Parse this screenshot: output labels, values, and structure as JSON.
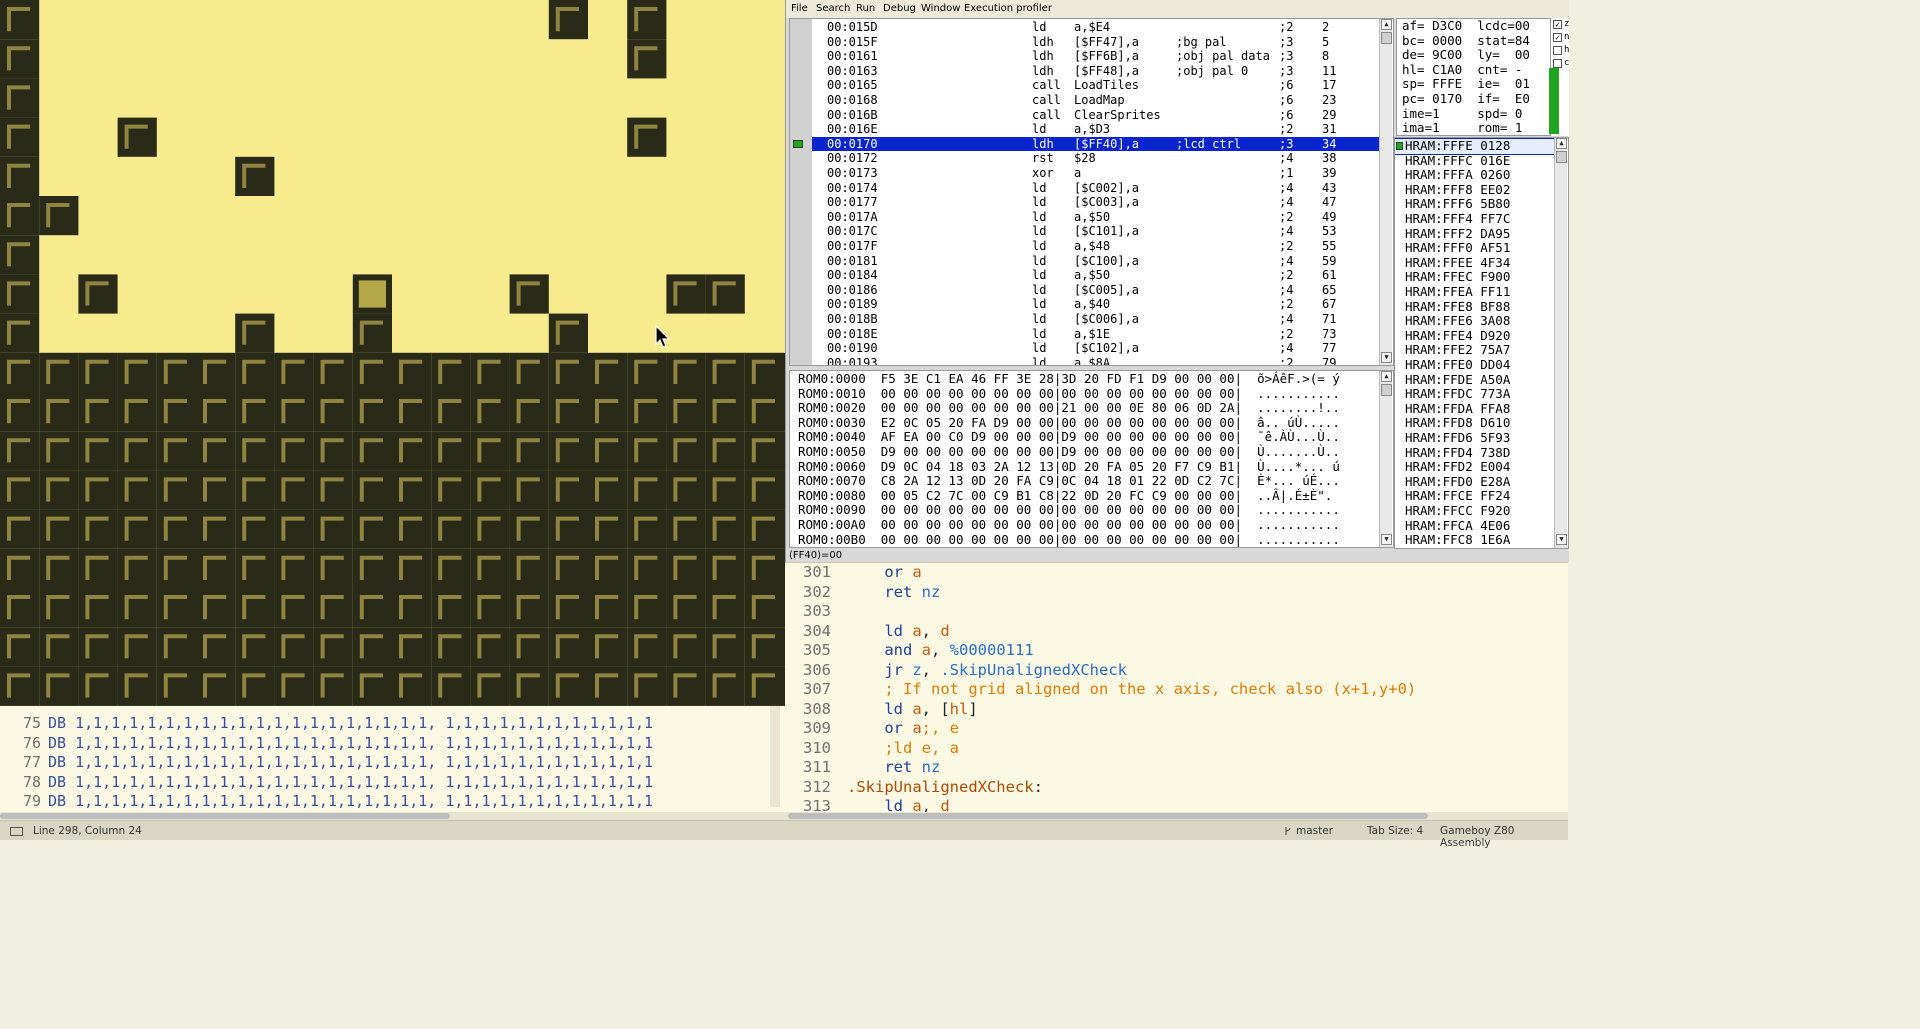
{
  "left_editor": {
    "lines": [
      {
        "num": "75",
        "text": "DB 1,1,1,1,1,1,1,1,1,1,1,1,1,1,1,1,1,1,1,1, 1,1,1,1,1,1,1,1,1,1,1,1"
      },
      {
        "num": "76",
        "text": "DB 1,1,1,1,1,1,1,1,1,1,1,1,1,1,1,1,1,1,1,1, 1,1,1,1,1,1,1,1,1,1,1,1"
      },
      {
        "num": "77",
        "text": "DB 1,1,1,1,1,1,1,1,1,1,1,1,1,1,1,1,1,1,1,1, 1,1,1,1,1,1,1,1,1,1,1,1"
      },
      {
        "num": "78",
        "text": "DB 1,1,1,1,1,1,1,1,1,1,1,1,1,1,1,1,1,1,1,1, 1,1,1,1,1,1,1,1,1,1,1,1"
      },
      {
        "num": "79",
        "text": "DB 1,1,1,1,1,1,1,1,1,1,1,1,1,1,1,1,1,1,1,1, 1,1,1,1,1,1,1,1,1,1,1,1"
      }
    ]
  },
  "game": {
    "colors": {
      "bg": "#f7eb8d",
      "dark": "#2a2a18",
      "mid": "#8f8540",
      "sprite": "#b5a84a"
    },
    "blocks": [
      [
        0,
        0
      ],
      [
        0,
        1
      ],
      [
        0,
        2
      ],
      [
        0,
        3
      ],
      [
        0,
        4
      ],
      [
        0,
        5
      ],
      [
        0,
        6
      ],
      [
        0,
        7
      ],
      [
        0,
        8
      ],
      [
        14,
        0
      ],
      [
        16,
        0
      ],
      [
        16,
        1
      ],
      [
        3,
        3
      ],
      [
        16,
        3
      ],
      [
        6,
        4
      ],
      [
        1,
        5
      ],
      [
        2,
        7
      ],
      [
        13,
        7
      ],
      [
        17,
        7
      ],
      [
        18,
        7
      ],
      [
        6,
        8
      ],
      [
        9,
        8
      ],
      [
        14,
        8
      ]
    ],
    "sprite_cell": [
      9,
      7
    ],
    "floor_from_row": 9
  },
  "debugger": {
    "menu": [
      "File",
      "Search",
      "Run",
      "Debug",
      "Window",
      "Execution profiler"
    ],
    "disasm": [
      {
        "addr": "00:015D",
        "op": "ld",
        "args": "a,$E4",
        "cm": "",
        "cyc": ";2",
        "tot": "2"
      },
      {
        "addr": "00:015F",
        "op": "ldh",
        "args": "[$FF47],a",
        "cm": ";bg pal",
        "cyc": ";3",
        "tot": "5"
      },
      {
        "addr": "00:0161",
        "op": "ldh",
        "args": "[$FF6B],a",
        "cm": ";obj pal data",
        "cyc": ";3",
        "tot": "8"
      },
      {
        "addr": "00:0163",
        "op": "ldh",
        "args": "[$FF48],a",
        "cm": ";obj pal 0",
        "cyc": ";3",
        "tot": "11"
      },
      {
        "addr": "00:0165",
        "op": "call",
        "args": "LoadTiles",
        "cm": "",
        "cyc": ";6",
        "tot": "17"
      },
      {
        "addr": "00:0168",
        "op": "call",
        "args": "LoadMap",
        "cm": "",
        "cyc": ";6",
        "tot": "23"
      },
      {
        "addr": "00:016B",
        "op": "call",
        "args": "ClearSprites",
        "cm": "",
        "cyc": ";6",
        "tot": "29"
      },
      {
        "addr": "00:016E",
        "op": "ld",
        "args": "a,$D3",
        "cm": "",
        "cyc": ";2",
        "tot": "31"
      },
      {
        "addr": "00:0170",
        "op": "ldh",
        "args": "[$FF40],a",
        "cm": ";lcd ctrl",
        "cyc": ";3",
        "tot": "34"
      },
      {
        "addr": "00:0172",
        "op": "rst",
        "args": "$28",
        "cm": "",
        "cyc": ";4",
        "tot": "38"
      },
      {
        "addr": "00:0173",
        "op": "xor",
        "args": "a",
        "cm": "",
        "cyc": ";1",
        "tot": "39"
      },
      {
        "addr": "00:0174",
        "op": "ld",
        "args": "[$C002],a",
        "cm": "",
        "cyc": ";4",
        "tot": "43"
      },
      {
        "addr": "00:0177",
        "op": "ld",
        "args": "[$C003],a",
        "cm": "",
        "cyc": ";4",
        "tot": "47"
      },
      {
        "addr": "00:017A",
        "op": "ld",
        "args": "a,$50",
        "cm": "",
        "cyc": ";2",
        "tot": "49"
      },
      {
        "addr": "00:017C",
        "op": "ld",
        "args": "[$C101],a",
        "cm": "",
        "cyc": ";4",
        "tot": "53"
      },
      {
        "addr": "00:017F",
        "op": "ld",
        "args": "a,$48",
        "cm": "",
        "cyc": ";2",
        "tot": "55"
      },
      {
        "addr": "00:0181",
        "op": "ld",
        "args": "[$C100],a",
        "cm": "",
        "cyc": ";4",
        "tot": "59"
      },
      {
        "addr": "00:0184",
        "op": "ld",
        "args": "a,$50",
        "cm": "",
        "cyc": ";2",
        "tot": "61"
      },
      {
        "addr": "00:0186",
        "op": "ld",
        "args": "[$C005],a",
        "cm": "",
        "cyc": ";4",
        "tot": "65"
      },
      {
        "addr": "00:0189",
        "op": "ld",
        "args": "a,$40",
        "cm": "",
        "cyc": ";2",
        "tot": "67"
      },
      {
        "addr": "00:018B",
        "op": "ld",
        "args": "[$C006],a",
        "cm": "",
        "cyc": ";4",
        "tot": "71"
      },
      {
        "addr": "00:018E",
        "op": "ld",
        "args": "a,$1E",
        "cm": "",
        "cyc": ";2",
        "tot": "73"
      },
      {
        "addr": "00:0190",
        "op": "ld",
        "args": "[$C102],a",
        "cm": "",
        "cyc": ";4",
        "tot": "77"
      },
      {
        "addr": "00:0193",
        "op": "ld",
        "args": "a,$8A",
        "cm": "",
        "cyc": ";2",
        "tot": "79"
      }
    ],
    "registers": [
      "af= D3C0  lcdc=00",
      "bc= 0000  stat=84",
      "de= 9C00  ly=  00",
      "hl= C1A0  cnt= -",
      "sp= FFFE  ie=  01",
      "pc= 0170  if=  E0",
      "ime=1     spd= 0",
      "ima=1     rom= 1"
    ],
    "flags": [
      {
        "label": "z",
        "checked": true
      },
      {
        "label": "n",
        "checked": true
      },
      {
        "label": "h",
        "checked": false
      },
      {
        "label": "c",
        "checked": false
      }
    ],
    "stack": [
      "HRAM:FFFE 0128",
      "HRAM:FFFC 016E",
      "HRAM:FFFA 0260",
      "HRAM:FFF8 EE02",
      "HRAM:FFF6 5B80",
      "HRAM:FFF4 FF7C",
      "HRAM:FFF2 DA95",
      "HRAM:FFF0 AF51",
      "HRAM:FFEE 4F34",
      "HRAM:FFEC F900",
      "HRAM:FFEA FF11",
      "HRAM:FFE8 BF88",
      "HRAM:FFE6 3A08",
      "HRAM:FFE4 D920",
      "HRAM:FFE2 75A7",
      "HRAM:FFE0 DD04",
      "HRAM:FFDE A50A",
      "HRAM:FFDC 773A",
      "HRAM:FFDA FFA8",
      "HRAM:FFD8 D610",
      "HRAM:FFD6 5F93",
      "HRAM:FFD4 738D",
      "HRAM:FFD2 E004",
      "HRAM:FFD0 E28A",
      "HRAM:FFCE FF24",
      "HRAM:FFCC F920",
      "HRAM:FFCA 4E06",
      "HRAM:FFC8 1E6A"
    ],
    "memory": [
      "ROM0:0000  F5 3E C1 EA 46 FF 3E 28|3D 20 FD F1 D9 00 00 00|  õ>ÁêF.>(= ý",
      "ROM0:0010  00 00 00 00 00 00 00 00|00 00 00 00 00 00 00 00|  ...........",
      "ROM0:0020  00 00 00 00 00 00 00 00|21 00 00 0E 80 06 0D 2A|  ........!..",
      "ROM0:0030  E2 0C 05 20 FA D9 00 00|00 00 00 00 00 00 00 00|  â.. úÙ.....",
      "ROM0:0040  AF EA 00 C0 D9 00 00 00|D9 00 00 00 00 00 00 00|  ¯ê.ÀÙ...Ù..",
      "ROM0:0050  D9 00 00 00 00 00 00 00|D9 00 00 00 00 00 00 00|  Ù.......Ù..",
      "ROM0:0060  D9 0C 04 18 03 2A 12 13|0D 20 FA 05 20 F7 C9 B1|  Ù....*... ú",
      "ROM0:0070  C8 2A 12 13 0D 20 FA C9|0C 04 18 01 22 0D C2 7C|  È*... úÉ...",
      "ROM0:0080  00 05 C2 7C 00 C9 B1 C8|22 0D 20 FC C9 00 00 00|  ..Â|.É±È\".",
      "ROM0:0090  00 00 00 00 00 00 00 00|00 00 00 00 00 00 00 00|  ...........",
      "ROM0:00A0  00 00 00 00 00 00 00 00|00 00 00 00 00 00 00 00|  ...........",
      "ROM0:00B0  00 00 00 00 00 00 00 00|00 00 00 00 00 00 00 00|  ..........."
    ],
    "status": "(FF40)=00"
  },
  "editor": {
    "lines": [
      {
        "num": "301",
        "indent": "    ",
        "parts": [
          {
            "t": "or",
            "c": "k"
          },
          {
            "t": " a",
            "c": "n"
          }
        ]
      },
      {
        "num": "302",
        "indent": "    ",
        "parts": [
          {
            "t": "ret",
            "c": "k"
          },
          {
            "t": " nz",
            "c": "r"
          }
        ]
      },
      {
        "num": "303",
        "indent": "",
        "parts": []
      },
      {
        "num": "304",
        "indent": "    ",
        "parts": [
          {
            "t": "ld",
            "c": "k"
          },
          {
            "t": " a",
            "c": "n"
          },
          {
            "t": ", ",
            "c": "b"
          },
          {
            "t": "d",
            "c": "n"
          }
        ]
      },
      {
        "num": "305",
        "indent": "    ",
        "parts": [
          {
            "t": "and",
            "c": "k"
          },
          {
            "t": " a",
            "c": "n"
          },
          {
            "t": ", ",
            "c": "b"
          },
          {
            "t": "%00000111",
            "c": "r"
          }
        ]
      },
      {
        "num": "306",
        "indent": "    ",
        "parts": [
          {
            "t": "jr",
            "c": "k"
          },
          {
            "t": " z",
            "c": "r"
          },
          {
            "t": ", ",
            "c": "b"
          },
          {
            "t": ".SkipUnalignedXCheck",
            "c": "r"
          }
        ]
      },
      {
        "num": "307",
        "indent": "    ",
        "parts": [
          {
            "t": "; If not grid aligned on the x axis, check also (x+1,y+0)",
            "c": "c"
          }
        ]
      },
      {
        "num": "308",
        "indent": "    ",
        "parts": [
          {
            "t": "ld",
            "c": "k"
          },
          {
            "t": " a",
            "c": "n"
          },
          {
            "t": ", [",
            "c": "b"
          },
          {
            "t": "hl",
            "c": "n"
          },
          {
            "t": "]",
            "c": "b"
          }
        ]
      },
      {
        "num": "309",
        "indent": "    ",
        "parts": [
          {
            "t": "or",
            "c": "k"
          },
          {
            "t": " a",
            "c": "n"
          },
          {
            "t": ";, e",
            "c": "c"
          }
        ]
      },
      {
        "num": "310",
        "indent": "    ",
        "parts": [
          {
            "t": ";ld e, a",
            "c": "c"
          }
        ]
      },
      {
        "num": "311",
        "indent": "    ",
        "parts": [
          {
            "t": "ret",
            "c": "k"
          },
          {
            "t": " nz",
            "c": "r"
          }
        ]
      },
      {
        "num": "312",
        "indent": "",
        "parts": [
          {
            "t": ".SkipUnalignedXCheck",
            "c": "l"
          },
          {
            "t": ":",
            "c": "b"
          }
        ]
      },
      {
        "num": "313",
        "indent": "    ",
        "parts": [
          {
            "t": "ld",
            "c": "k"
          },
          {
            "t": " a",
            "c": "n"
          },
          {
            "t": ", ",
            "c": "b"
          },
          {
            "t": "d",
            "c": "n"
          }
        ]
      }
    ]
  },
  "statusbar": {
    "position": "Line 298, Column 24",
    "branch": "master",
    "tab_size": "Tab Size: 4",
    "syntax": "Gameboy Z80 Assembly"
  }
}
